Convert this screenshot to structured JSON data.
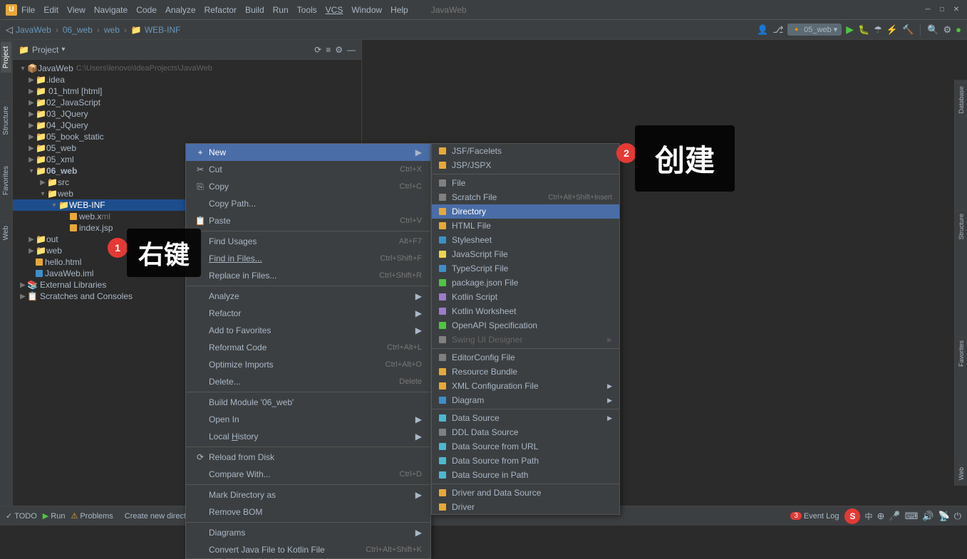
{
  "titlebar": {
    "app_icon": "U",
    "menu": [
      "File",
      "Edit",
      "View",
      "Navigate",
      "Code",
      "Analyze",
      "Refactor",
      "Build",
      "Run",
      "Tools",
      "VCS",
      "Window",
      "Help"
    ],
    "project_label": "JavaWeb",
    "window_title": "JavaWeb"
  },
  "toolbar": {
    "breadcrumbs": [
      "JavaWeb",
      "06_web",
      "web",
      "WEB-INF"
    ],
    "run_config": "05_web"
  },
  "project_panel": {
    "title": "Project",
    "root": "JavaWeb",
    "root_path": "C:\\Users\\lenovo\\IdeaProjects\\JavaWeb"
  },
  "file_tree": [
    {
      "level": 0,
      "name": "JavaWeb",
      "type": "project",
      "path": "C:\\Users\\lenovo\\IdeaProjects\\JavaWeb",
      "expanded": true
    },
    {
      "level": 1,
      "name": ".idea",
      "type": "folder",
      "expanded": false
    },
    {
      "level": 1,
      "name": "01_html [html]",
      "type": "folder",
      "expanded": false
    },
    {
      "level": 1,
      "name": "02_JavaScript",
      "type": "folder",
      "expanded": false
    },
    {
      "level": 1,
      "name": "03_JQuery",
      "type": "folder",
      "expanded": false
    },
    {
      "level": 1,
      "name": "04_JQuery",
      "type": "folder",
      "expanded": false
    },
    {
      "level": 1,
      "name": "05_book_static",
      "type": "folder",
      "expanded": false
    },
    {
      "level": 1,
      "name": "05_web",
      "type": "folder",
      "expanded": false
    },
    {
      "level": 1,
      "name": "05_xml",
      "type": "folder",
      "expanded": false
    },
    {
      "level": 1,
      "name": "06_web",
      "type": "folder",
      "expanded": true
    },
    {
      "level": 2,
      "name": "src",
      "type": "folder",
      "expanded": false
    },
    {
      "level": 2,
      "name": "web",
      "type": "folder",
      "expanded": true
    },
    {
      "level": 3,
      "name": "WEB-INF",
      "type": "folder",
      "expanded": true,
      "selected": true
    },
    {
      "level": 4,
      "name": "web.xml",
      "type": "xml"
    },
    {
      "level": 4,
      "name": "index.jsp",
      "type": "jsp"
    },
    {
      "level": 1,
      "name": "out",
      "type": "folder",
      "expanded": false
    },
    {
      "level": 1,
      "name": "web",
      "type": "folder",
      "expanded": false
    },
    {
      "level": 1,
      "name": "hello.html",
      "type": "html"
    },
    {
      "level": 1,
      "name": "JavaWeb.iml",
      "type": "iml"
    },
    {
      "level": 0,
      "name": "External Libraries",
      "type": "special",
      "expanded": false
    },
    {
      "level": 0,
      "name": "Scratches and Consoles",
      "type": "scratches",
      "expanded": false
    }
  ],
  "context_menu": {
    "items": [
      {
        "label": "New",
        "has_arrow": true,
        "highlighted": true
      },
      {
        "label": "Cut",
        "shortcut": "Ctrl+X",
        "icon": "cut"
      },
      {
        "label": "Copy",
        "shortcut": "Ctrl+C",
        "icon": "copy"
      },
      {
        "label": "Copy Path...",
        "icon": ""
      },
      {
        "label": "Paste",
        "shortcut": "Ctrl+V",
        "icon": "paste"
      },
      {
        "separator": true
      },
      {
        "label": "Find Usages",
        "shortcut": "Alt+F7"
      },
      {
        "label": "Find in Files...",
        "shortcut": "Ctrl+Shift+F"
      },
      {
        "label": "Replace in Files...",
        "shortcut": "Ctrl+Shift+R"
      },
      {
        "separator": true
      },
      {
        "label": "Analyze",
        "has_arrow": true
      },
      {
        "label": "Refactor",
        "has_arrow": true
      },
      {
        "label": "Add to Favorites",
        "has_arrow": true
      },
      {
        "label": "Reformat Code",
        "shortcut": "Ctrl+Alt+L"
      },
      {
        "label": "Optimize Imports",
        "shortcut": "Ctrl+Alt+O"
      },
      {
        "label": "Delete...",
        "shortcut": "Delete"
      },
      {
        "separator": true
      },
      {
        "label": "Build Module '06_web'"
      },
      {
        "label": "Open In",
        "has_arrow": true
      },
      {
        "label": "Local History",
        "has_arrow": true
      },
      {
        "separator": true
      },
      {
        "label": "Reload from Disk",
        "icon": "reload"
      },
      {
        "label": "Compare With...",
        "shortcut": "Ctrl+D"
      },
      {
        "separator": true
      },
      {
        "label": "Mark Directory as",
        "has_arrow": true
      },
      {
        "label": "Remove BOM"
      },
      {
        "separator": true
      },
      {
        "label": "Diagrams",
        "has_arrow": true
      },
      {
        "label": "Convert Java File to Kotlin File",
        "shortcut": "Ctrl+Alt+Shift+K"
      }
    ]
  },
  "new_submenu": {
    "items": [
      {
        "label": "JSF/Facelets",
        "icon": "jsf",
        "color": "orange"
      },
      {
        "label": "JSP/JSPX",
        "icon": "jsp",
        "color": "orange"
      },
      {
        "separator": true
      },
      {
        "label": "File",
        "icon": "file",
        "color": "gray"
      },
      {
        "label": "Scratch File",
        "shortcut": "Ctrl+Alt+Shift+Insert",
        "icon": "scratch",
        "color": "gray"
      },
      {
        "label": "Directory",
        "icon": "dir",
        "color": "orange",
        "active": true
      },
      {
        "label": "HTML File",
        "icon": "html",
        "color": "orange"
      },
      {
        "label": "Stylesheet",
        "icon": "css",
        "color": "blue"
      },
      {
        "label": "JavaScript File",
        "icon": "js",
        "color": "yellow"
      },
      {
        "label": "TypeScript File",
        "icon": "ts",
        "color": "blue"
      },
      {
        "label": "package.json File",
        "icon": "json",
        "color": "green"
      },
      {
        "label": "Kotlin Script",
        "icon": "kotlin",
        "color": "purple"
      },
      {
        "label": "Kotlin Worksheet",
        "icon": "kotlin",
        "color": "purple"
      },
      {
        "label": "OpenAPI Specification",
        "icon": "api",
        "color": "green"
      },
      {
        "label": "Swing UI Designer",
        "icon": "swing",
        "color": "gray",
        "disabled": true
      },
      {
        "separator": true
      },
      {
        "label": "EditorConfig File",
        "icon": "editor",
        "color": "gray"
      },
      {
        "label": "Resource Bundle",
        "icon": "res",
        "color": "orange"
      },
      {
        "label": "XML Configuration File",
        "icon": "xml",
        "color": "orange",
        "has_arrow": true
      },
      {
        "label": "Diagram",
        "icon": "diagram",
        "color": "blue",
        "has_arrow": true
      },
      {
        "separator": true
      },
      {
        "label": "Data Source",
        "icon": "db",
        "color": "blue",
        "has_arrow": true
      },
      {
        "label": "DDL Data Source",
        "icon": "ddl",
        "color": "gray"
      },
      {
        "label": "Data Source from URL",
        "icon": "db",
        "color": "blue"
      },
      {
        "label": "Data Source from Path",
        "icon": "db",
        "color": "blue"
      },
      {
        "label": "Data Source in Path",
        "icon": "db",
        "color": "blue"
      },
      {
        "separator": true
      },
      {
        "label": "Driver and Data Source",
        "icon": "driver",
        "color": "orange"
      },
      {
        "label": "Driver",
        "icon": "driver",
        "color": "orange"
      }
    ]
  },
  "status_bar": {
    "todo_label": "TODO",
    "run_label": "Run",
    "problems_label": "Problems",
    "bottom_msg": "Create new directory or package",
    "event_log": "Event Log",
    "event_log_count": "3"
  },
  "annotations": {
    "circle1_num": "1",
    "circle2_num": "2",
    "step1_label": "右键",
    "step2_label": "创建"
  },
  "right_panels": {
    "database": "Database",
    "structure": "Structure",
    "favorites": "Favorites",
    "web": "Web"
  },
  "system_tray": {
    "icons": [
      "中",
      "⊕",
      "🎤",
      "⌨",
      "🔊",
      "📡",
      "⏻"
    ]
  }
}
